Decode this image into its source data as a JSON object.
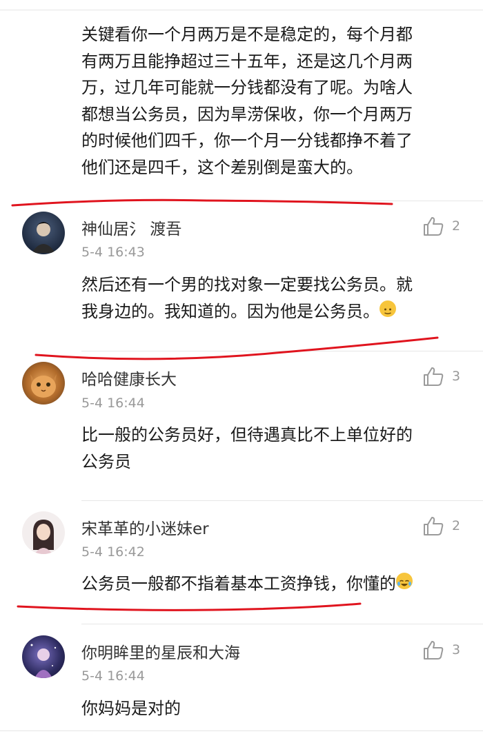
{
  "first_comment": {
    "text": "关键看你一个月两万是不是稳定的，每个月都\n有两万且能挣超过三十五年，还是这几个月两\n万，过几年可能就一分钱都没有了呢。为啥人\n都想当公务员，因为旱涝保收，你一个月两万\n的时候他们四千，你一个月一分钱都挣不着了\n他们还是四千，这个差别倒是蛮大的。"
  },
  "comments": [
    {
      "username": "神仙居氵 渡吾",
      "time": "5-4 16:43",
      "likes": "2",
      "text": "然后还有一个男的找对象一定要找公务员。就\n我身边的。我知道的。因为他是公务员。",
      "emoji": "slight-smile-emoji"
    },
    {
      "username": "哈哈健康长大",
      "time": "5-4 16:44",
      "likes": "3",
      "text": "比一般的公务员好，但待遇真比不上单位好的\n公务员"
    },
    {
      "username": "宋革革的小迷妹er",
      "time": "5-4 16:42",
      "likes": "2",
      "text": "公务员一般都不指着基本工资挣钱，你懂的",
      "emoji": "laugh-cry-emoji"
    },
    {
      "username": "你明眸里的星辰和大海",
      "time": "5-4 16:44",
      "likes": "3",
      "text": "你妈妈是对的"
    }
  ],
  "icons": {
    "like": "thumbs-up-icon"
  },
  "colors": {
    "annotation_red": "#e0141e",
    "time_gray": "#999999",
    "divider": "#e6e6e6"
  }
}
